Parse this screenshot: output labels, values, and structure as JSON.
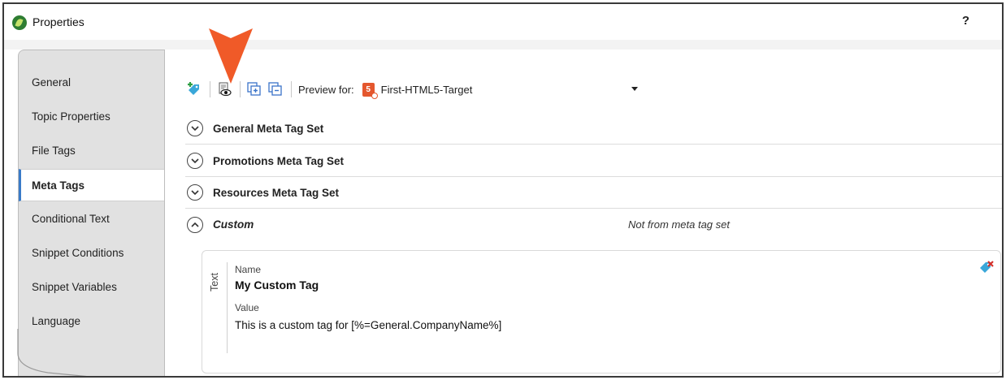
{
  "window": {
    "title": "Properties",
    "help_label": "?"
  },
  "sidebar": {
    "items": [
      {
        "label": "General"
      },
      {
        "label": "Topic Properties"
      },
      {
        "label": "File Tags"
      },
      {
        "label": "Meta Tags",
        "active": true
      },
      {
        "label": "Conditional Text"
      },
      {
        "label": "Snippet Conditions"
      },
      {
        "label": "Snippet Variables"
      },
      {
        "label": "Language"
      }
    ]
  },
  "toolbar": {
    "icons": [
      "add-tag-icon",
      "preview-icon",
      "expand-all-icon",
      "collapse-all-icon"
    ],
    "preview_label": "Preview for:",
    "preview_value": "First-HTML5-Target",
    "accent_color": "#e4572e"
  },
  "sections": [
    {
      "title": "General Meta Tag Set",
      "state": "collapsed"
    },
    {
      "title": "Promotions Meta Tag Set",
      "state": "collapsed"
    },
    {
      "title": "Resources Meta Tag Set",
      "state": "collapsed"
    },
    {
      "title": "Custom",
      "state": "expanded",
      "note": "Not from meta tag set"
    }
  ],
  "custom_tag": {
    "type_label": "Text",
    "name_label": "Name",
    "name_value": "My Custom Tag",
    "value_label": "Value",
    "value_text": "This is a custom tag for [%=General.CompanyName%]"
  },
  "annotation": {
    "pointer_color": "#f05a28"
  }
}
